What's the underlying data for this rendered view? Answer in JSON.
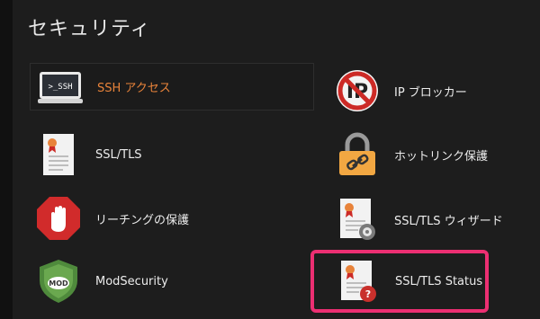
{
  "section": {
    "title": "セキュリティ"
  },
  "items": [
    {
      "label": "SSH アクセス",
      "icon": "ssh-terminal-icon"
    },
    {
      "label": "IP ブロッカー",
      "icon": "ip-blocker-icon"
    },
    {
      "label": "SSL/TLS",
      "icon": "certificate-icon"
    },
    {
      "label": "ホットリンク保護",
      "icon": "padlock-link-icon"
    },
    {
      "label": "リーチングの保護",
      "icon": "stop-hand-icon"
    },
    {
      "label": "SSL/TLS ウィザード",
      "icon": "certificate-wizard-icon"
    },
    {
      "label": "ModSecurity",
      "icon": "mod-shield-icon"
    },
    {
      "label": "SSL/TLS Status",
      "icon": "certificate-status-icon"
    }
  ],
  "icon_text": {
    "ssh": ">_SSH",
    "ip": "IP",
    "mod": "MOD",
    "question": "?"
  },
  "colors": {
    "hover_label": "#e8833a",
    "highlight_border": "#ec2f72",
    "background": "#1d1d1d"
  }
}
